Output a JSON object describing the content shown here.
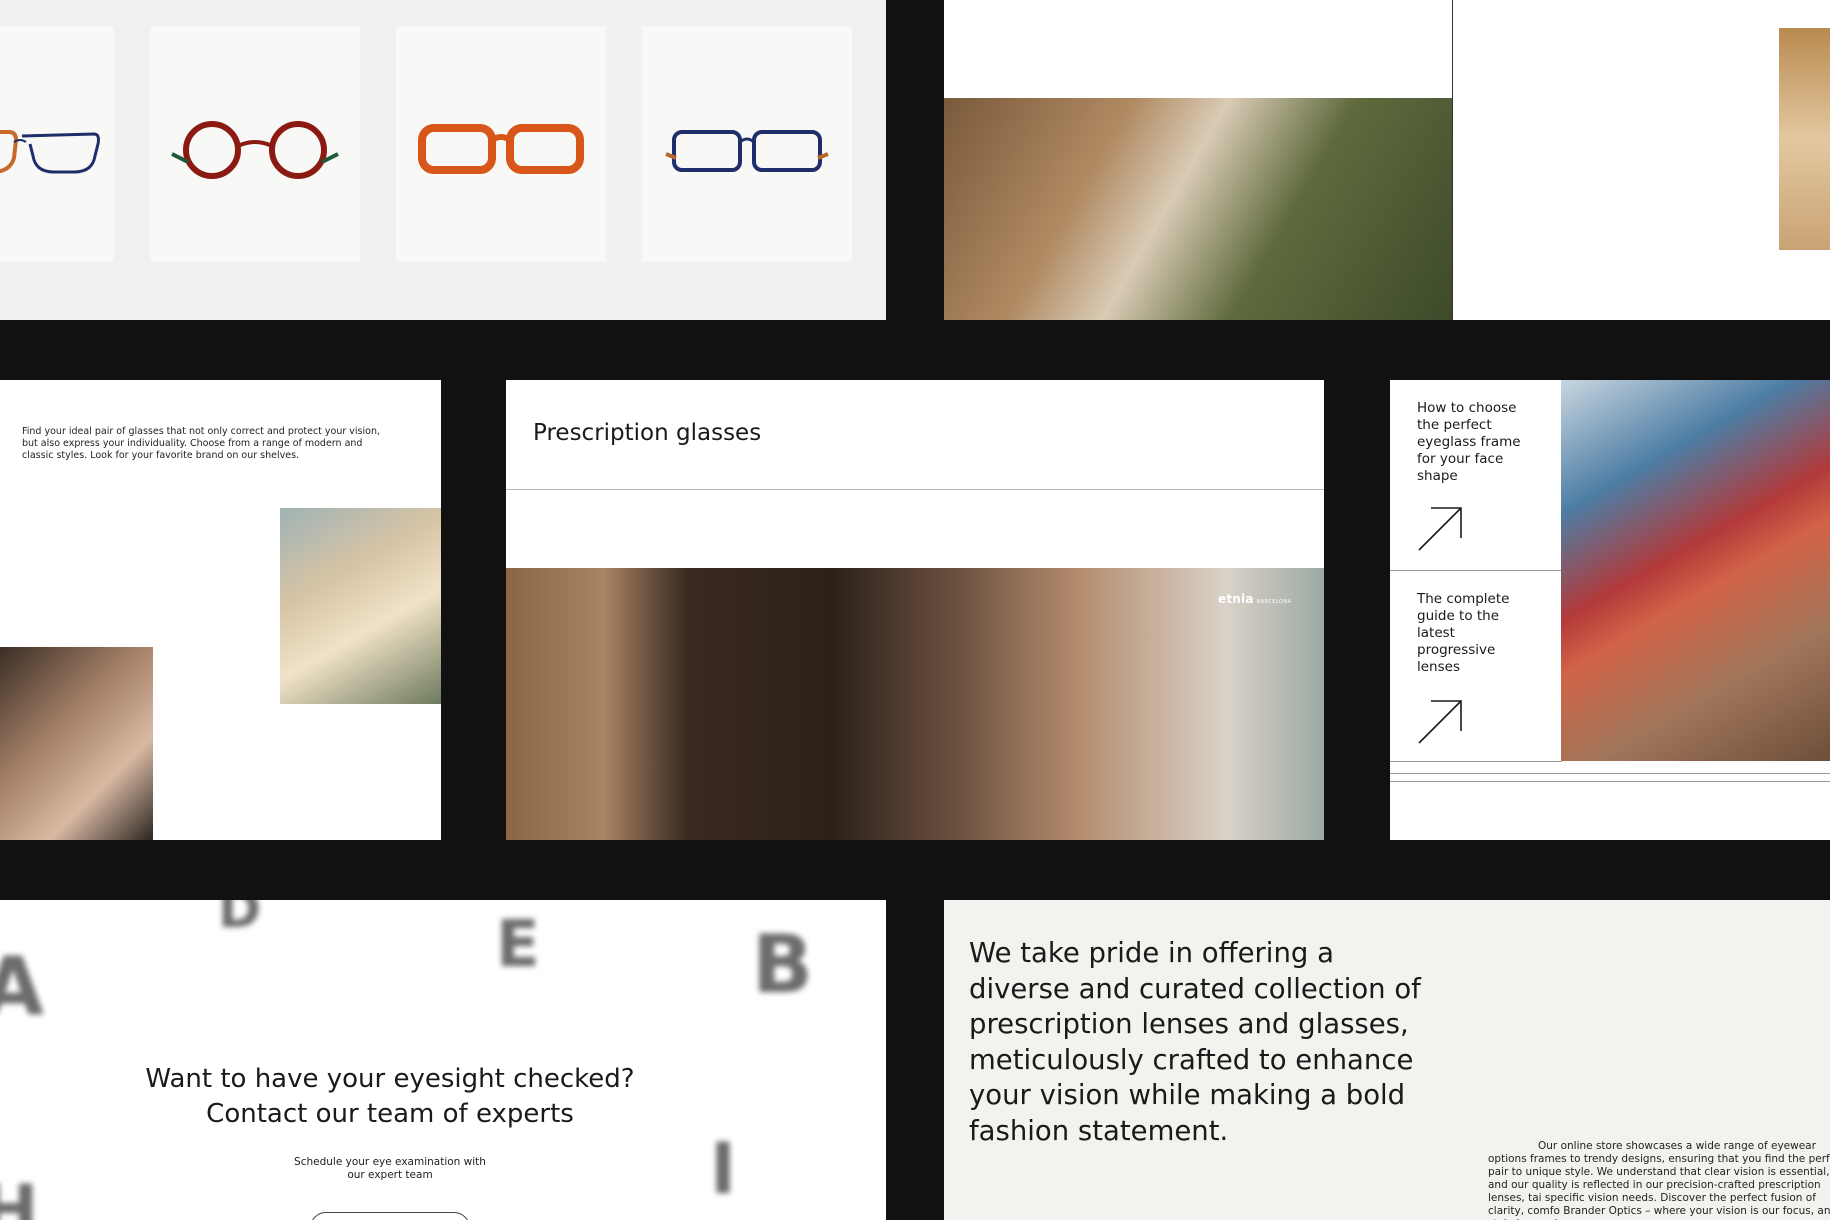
{
  "colors": {
    "background": "#111111",
    "frame_red": "#8b1a12",
    "frame_orange": "#d8561a",
    "frame_navy": "#1f2e6b",
    "frame_tortoise": "#b9682a"
  },
  "products": [
    {
      "name": "navy-tortoise-frame"
    },
    {
      "name": "red-round-frame"
    },
    {
      "name": "orange-rectangle-frame"
    },
    {
      "name": "navy-rectangle-frame"
    }
  ],
  "intro": {
    "text": "Find your ideal pair of glasses that not only correct and protect your vision, but also express your individuality. Choose from a range of modern and classic styles. Look for your favorite brand on our shelves."
  },
  "rx": {
    "title": "Prescription glasses",
    "brand": "etnia",
    "brand_sub": "BARCELONA"
  },
  "guides": [
    {
      "title": "How to choose the perfect eyeglass frame for your face shape",
      "icon": "arrow-up-right-icon"
    },
    {
      "title": "The complete guide to the latest progressive lenses",
      "icon": "arrow-up-right-icon"
    }
  ],
  "eye": {
    "letters": [
      "D",
      "E",
      "B",
      "A",
      "I",
      "H"
    ],
    "headline_1": "Want to have your eyesight checked?",
    "headline_2": "Contact our team of experts",
    "sub_1": "Schedule your eye examination with",
    "sub_2": "our expert team"
  },
  "pride": {
    "statement": "We take pride in offering a diverse and curated collection of prescription lenses and glasses, meticulously crafted to enhance your vision while making a bold fashion statement.",
    "body": "Our online store showcases a wide range of eyewear options frames to trendy designs, ensuring that you find the perfect pair to unique style. We understand that clear vision is essential, and our quality is reflected in our precision-crafted prescription lenses, tai specific vision needs. Discover the perfect fusion of clarity, comfo Brander Optics – where your vision is our focus, and style is our sig"
  }
}
